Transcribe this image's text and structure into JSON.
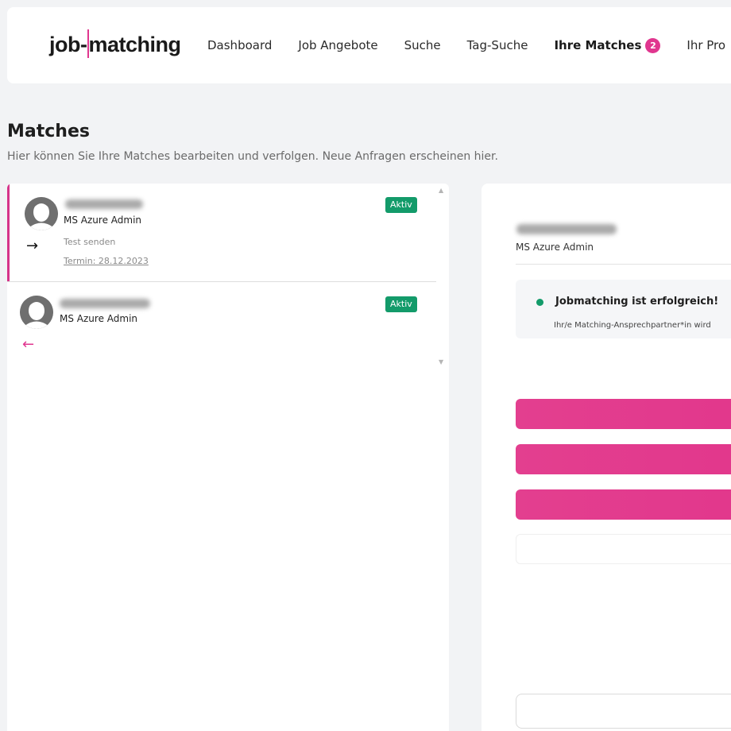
{
  "brand": {
    "logo_prefix": "job-",
    "logo_m": "m",
    "logo_suffix": "atching"
  },
  "nav": {
    "items": [
      {
        "label": "Dashboard"
      },
      {
        "label": "Job Angebote"
      },
      {
        "label": "Suche"
      },
      {
        "label": "Tag-Suche"
      },
      {
        "label": "Ihre Matches",
        "badge": "2",
        "active": true
      },
      {
        "label": "Ihr Pro"
      }
    ]
  },
  "page": {
    "title": "Matches",
    "subtitle": "Hier können Sie Ihre Matches bearbeiten und verfolgen. Neue Anfragen erscheinen hier."
  },
  "matches": [
    {
      "role": "MS Azure Admin",
      "status": "Aktiv",
      "direction_icon": "arrow-right-icon",
      "note": "Test senden",
      "appointment": "Termin: 28.12.2023",
      "selected": true
    },
    {
      "role": "MS Azure Admin",
      "status": "Aktiv",
      "direction_icon": "arrow-left-icon",
      "selected": false
    }
  ],
  "detail": {
    "role": "MS Azure Admin",
    "alert_title": "Jobmatching ist erfolgreich!",
    "alert_text": "Ihr/e Matching-Ansprechpartner*in wird"
  },
  "colors": {
    "accent": "#e0368f",
    "status_green": "#139b6a",
    "background": "#f2f3f5"
  }
}
